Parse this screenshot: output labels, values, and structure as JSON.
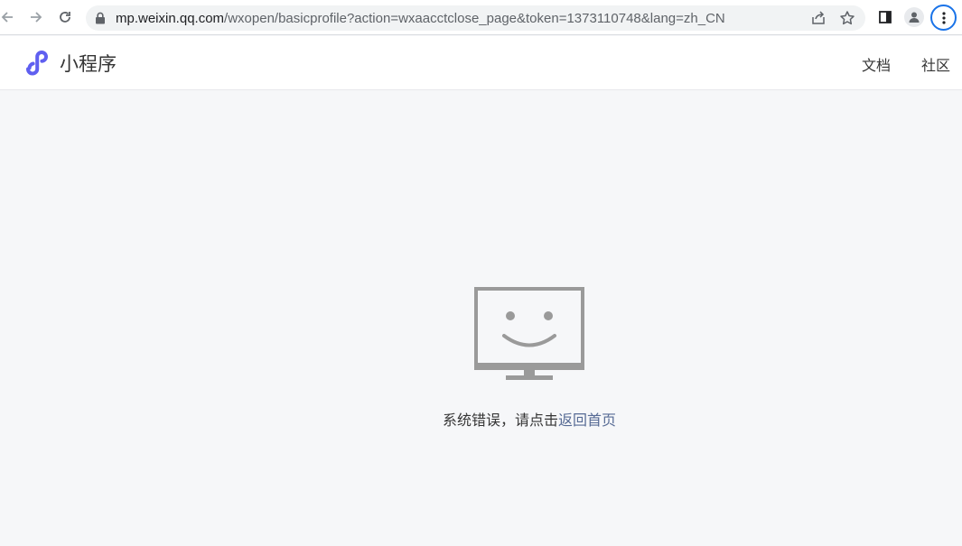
{
  "browser": {
    "url_host": "mp.weixin.qq.com",
    "url_rest": "/wxopen/basicprofile?action=wxaacctclose_page&token=1373110748&lang=zh_CN",
    "icons": [
      "back-icon",
      "forward-icon",
      "reload-icon",
      "lock-icon",
      "share-icon",
      "star-icon",
      "side-panel-icon",
      "profile-icon",
      "menu-icon"
    ]
  },
  "header": {
    "brand": "小程序",
    "nav": [
      {
        "label": "文档"
      },
      {
        "label": "社区"
      }
    ]
  },
  "main": {
    "illustration": "monitor-smiley-icon",
    "message_prefix": "系统错误，请点击",
    "message_link": "返回首页"
  },
  "colors": {
    "accent": "#576b95",
    "logo": "#5f5ff0",
    "illustration": "#9a9a9a",
    "background": "#f6f7f9"
  }
}
